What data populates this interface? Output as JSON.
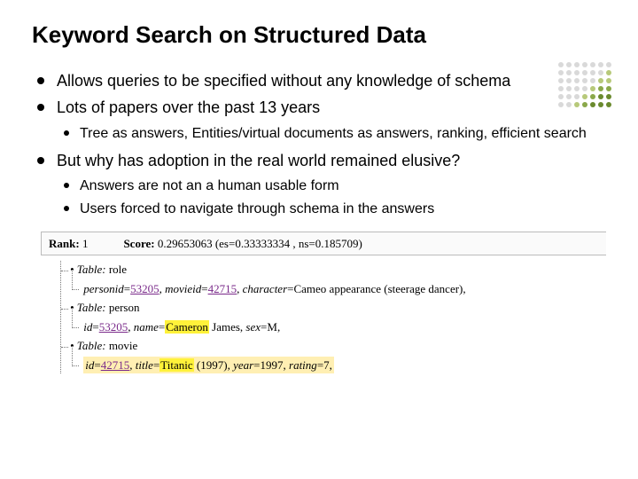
{
  "title": "Keyword Search on Structured Data",
  "bullets": {
    "b1": "Allows queries to be specified without any knowledge of schema",
    "b2": "Lots of papers over the past 13 years",
    "b2_sub1": "Tree as answers, Entities/virtual documents as answers, ranking, efficient search",
    "b3": "But why has adoption in the real world remained elusive?",
    "b3_sub1": "Answers are not an a human usable form",
    "b3_sub2": "Users forced to navigate through schema in the answers"
  },
  "example": {
    "rank_label": "Rank:",
    "rank_value": "1",
    "score_label": "Score:",
    "score_value": "0.29653063 (es=0.33333334 , ns=0.185709)",
    "table_label": "• Table:",
    "tables": {
      "role": {
        "name": "role",
        "fields": {
          "personid_k": "personid",
          "personid_v": "53205",
          "movieid_k": "movieid",
          "movieid_v": "42715",
          "character_k": "character",
          "character_v": "Cameo appearance (steerage dancer)"
        }
      },
      "person": {
        "name": "person",
        "fields": {
          "id_k": "id",
          "id_v": "53205",
          "name_k": "name",
          "name_v_first": "Cameron",
          "name_v_last": "James",
          "sex_k": "sex",
          "sex_v": "M"
        }
      },
      "movie": {
        "name": "movie",
        "fields": {
          "id_k": "id",
          "id_v": "42715",
          "title_k": "title",
          "title_v_hl": "Titanic",
          "title_v_rest": "(1997)",
          "year_k": "year",
          "year_v": "1997",
          "rating_k": "rating",
          "rating_v": "7"
        }
      }
    }
  },
  "deco_colors": [
    "#d9d9d9",
    "#d9d9d9",
    "#d9d9d9",
    "#d9d9d9",
    "#d9d9d9",
    "#d9d9d9",
    "#d9d9d9",
    "#d9d9d9",
    "#d9d9d9",
    "#d9d9d9",
    "#d9d9d9",
    "#d9d9d9",
    "#d9d9d9",
    "#b7c97a",
    "#d9d9d9",
    "#d9d9d9",
    "#d9d9d9",
    "#d9d9d9",
    "#d9d9d9",
    "#b7c97a",
    "#b7c97a",
    "#d9d9d9",
    "#d9d9d9",
    "#d9d9d9",
    "#d9d9d9",
    "#b7c97a",
    "#8aa84a",
    "#8aa84a",
    "#d9d9d9",
    "#d9d9d9",
    "#d9d9d9",
    "#b7c97a",
    "#8aa84a",
    "#6a8a2e",
    "#6a8a2e",
    "#d9d9d9",
    "#d9d9d9",
    "#b7c97a",
    "#8aa84a",
    "#6a8a2e",
    "#6a8a2e",
    "#6a8a2e"
  ]
}
